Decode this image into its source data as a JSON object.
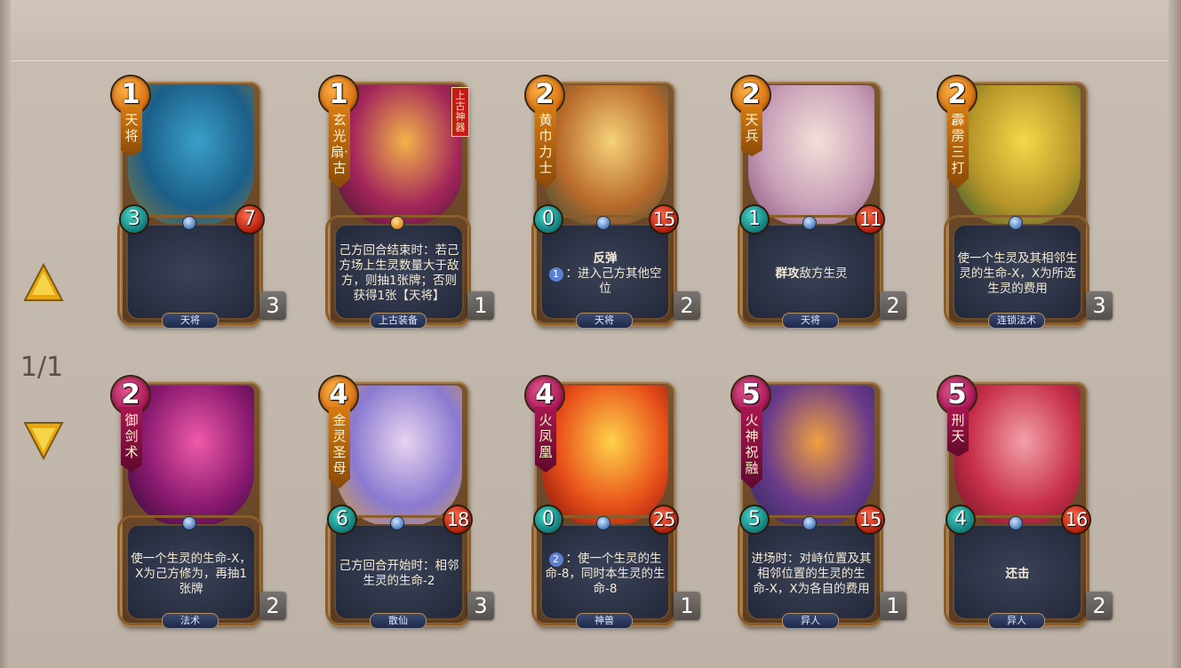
{
  "page": {
    "indicator": "1/1"
  },
  "nav": {
    "up_icon": "triangle-up-icon",
    "down_icon": "triangle-down-icon",
    "arrow_color": "#f2c122"
  },
  "cards": [
    {
      "cost": "1",
      "cost_color": "orange",
      "name": "天将",
      "artifact": "",
      "atk": "3",
      "hp": "7",
      "text": "",
      "type": "天将",
      "count": "3",
      "art": [
        "#3aa0c8",
        "#1b5f8a",
        "#8a7a38"
      ]
    },
    {
      "cost": "1",
      "cost_color": "orange",
      "name": "玄光扇·古",
      "artifact": "上古神器",
      "atk": "",
      "hp": "",
      "text": "己方回合结束时：若己方场上生灵数量大于敌方，则抽1张牌；否则获得1张【天将】",
      "type": "上古装备",
      "count": "1",
      "art": [
        "#f2b34a",
        "#a4265a",
        "#3d1430"
      ]
    },
    {
      "cost": "2",
      "cost_color": "orange",
      "name": "黄巾力士",
      "artifact": "",
      "atk": "0",
      "hp": "15",
      "text_bold": "反弹",
      "text_badge": "1",
      "text": "：进入己方其他空位",
      "type": "天将",
      "count": "2",
      "art": [
        "#f6d27a",
        "#b86a2a",
        "#2e4a3a"
      ]
    },
    {
      "cost": "2",
      "cost_color": "orange",
      "name": "天兵",
      "artifact": "",
      "atk": "1",
      "hp": "11",
      "text_bold": "群攻",
      "text": "敌方生灵",
      "type": "天将",
      "count": "2",
      "art": [
        "#f3e0d8",
        "#c8a0b8",
        "#8a5078"
      ]
    },
    {
      "cost": "2",
      "cost_color": "orange",
      "name": "霹雳三打",
      "artifact": "",
      "atk": "",
      "hp": "",
      "text": "使一个生灵及其相邻生灵的生命-X，X为所选生灵的费用",
      "type": "连锁法术",
      "count": "3",
      "art": [
        "#f5d84a",
        "#b7962a",
        "#2f5a2a"
      ]
    },
    {
      "cost": "2",
      "cost_color": "magenta",
      "name": "御剑术",
      "artifact": "",
      "atk": "",
      "hp": "",
      "text": "使一个生灵的生命-X，X为己方修为，再抽1张牌",
      "type": "法术",
      "count": "2",
      "art": [
        "#ef5aa8",
        "#8a1a70",
        "#2a0a30"
      ]
    },
    {
      "cost": "4",
      "cost_color": "orange",
      "name": "金灵圣母",
      "artifact": "",
      "atk": "6",
      "hp": "18",
      "text": "己方回合开始时：相邻生灵的生命-2",
      "type": "散仙",
      "count": "3",
      "art": [
        "#e8d3f0",
        "#8a7ad0",
        "#d8a040"
      ]
    },
    {
      "cost": "4",
      "cost_color": "magenta",
      "name": "火凤凰",
      "artifact": "",
      "atk": "0",
      "hp": "25",
      "text_badge": "2",
      "text": "：使一个生灵的生命-8，同时本生灵的生命-8",
      "type": "神兽",
      "count": "1",
      "art": [
        "#ffd24a",
        "#e8501a",
        "#7a0a08"
      ]
    },
    {
      "cost": "5",
      "cost_color": "magenta",
      "name": "火神祝融",
      "artifact": "",
      "atk": "5",
      "hp": "15",
      "text": "进场时：对峙位置及其相邻位置的生灵的生命-X，X为各自的费用",
      "type": "异人",
      "count": "1",
      "art": [
        "#f0a040",
        "#6a3a8a",
        "#2a2a5a"
      ]
    },
    {
      "cost": "5",
      "cost_color": "magenta",
      "name": "刑天",
      "artifact": "",
      "atk": "4",
      "hp": "16",
      "text_bold": "还击",
      "text": "",
      "type": "异人",
      "count": "2",
      "art": [
        "#f2a0a8",
        "#c8304a",
        "#6a1020"
      ]
    }
  ]
}
